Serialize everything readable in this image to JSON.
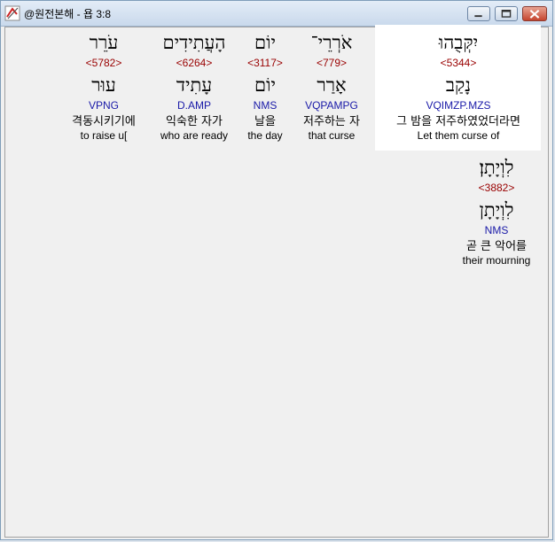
{
  "window": {
    "title": "@원전본해 - 욥 3:8"
  },
  "words": [
    {
      "hebrew": "יִקְּבֻהוּ",
      "strong": "<5344>",
      "lemma": "נָקַב",
      "parse": "VQIMZP.MZS",
      "korean": "그 밤을 저주하였었더라면",
      "english": "Let them curse of"
    },
    {
      "hebrew": "אֹרְרֵי־",
      "strong": "<779>",
      "lemma": "אָרַר",
      "parse": "VQPAMPG",
      "korean": "저주하는 자",
      "english": "that curse"
    },
    {
      "hebrew": "יוֹם",
      "strong": "<3117>",
      "lemma": "יוֹם",
      "parse": "NMS",
      "korean": "날을",
      "english": "the day"
    },
    {
      "hebrew": "הָעֲתִידִים",
      "strong": "<6264>",
      "lemma": "עָתִיד",
      "parse": "D.AMP",
      "korean": "익숙한 자가",
      "english": "who are ready"
    },
    {
      "hebrew": "עֹרֵר",
      "strong": "<5782>",
      "lemma": "עוּר",
      "parse": "VPNG",
      "korean": "격동시키기에",
      "english": "to raise u["
    },
    {
      "hebrew": "לִוְיָתָן׃",
      "strong": "<3882>",
      "lemma": "לִוְיָתָן",
      "parse": "NMS",
      "korean": "곧 큰 악어를",
      "english": "their mourning"
    }
  ]
}
